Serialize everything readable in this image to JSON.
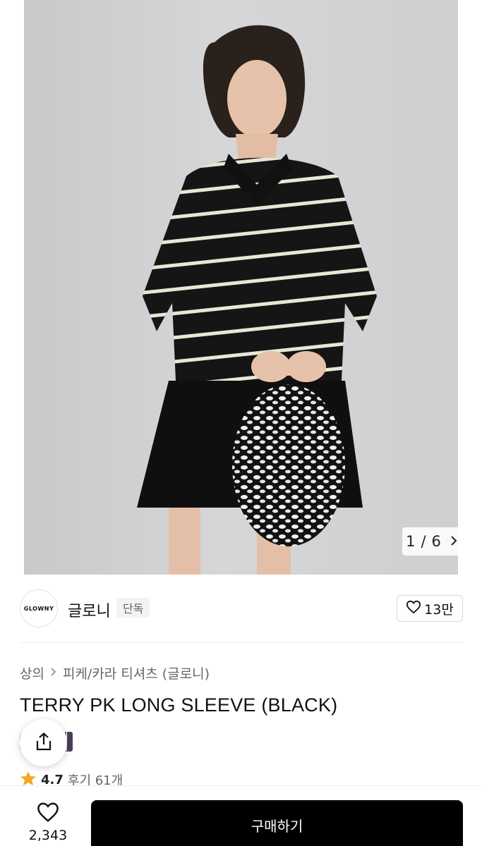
{
  "gallery": {
    "current": "1",
    "separator": "/",
    "total": "6",
    "next_icon": "chevron-right-icon"
  },
  "brand": {
    "logo_text": "GLOWNY",
    "name": "글로니",
    "tag": "단독",
    "likes": "13만"
  },
  "breadcrumb": {
    "category": "상의",
    "subcategory": "피케/카라 티셔츠 (글로니)"
  },
  "product": {
    "title": "TERRY PK LONG SLEEVE (BLACK)",
    "sale_badge": "세일"
  },
  "rating": {
    "score": "4.7",
    "reviews": "후기 61개",
    "star_color": "#f5a623"
  },
  "bottom": {
    "wish_count": "2,343",
    "buy_label": "구매하기"
  }
}
